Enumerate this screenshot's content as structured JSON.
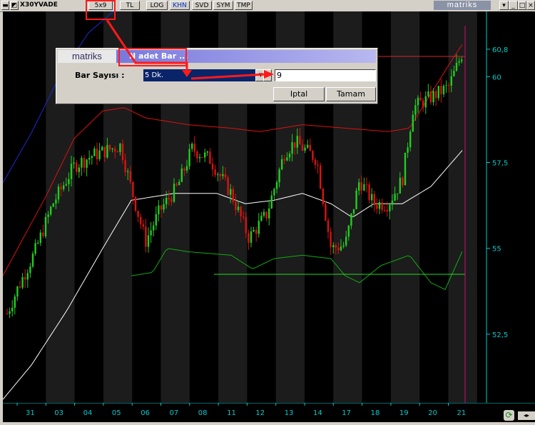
{
  "toolbar": {
    "symbol": "X30YVADE",
    "layout": "5x9",
    "buttons": [
      "TL",
      "LOG",
      "KHN",
      "SVD",
      "SYM",
      "TMP"
    ],
    "brand": "matriks",
    "active_button": "KHN"
  },
  "dialog": {
    "logo": "matriks",
    "title": "N adet Bar ...",
    "label": "Bar Sayısı :",
    "period": "5 Dk.",
    "bar_count": "9",
    "cancel": "Iptal",
    "ok": "Tamam"
  },
  "chart_data": {
    "type": "line",
    "price_axis_ticks": [
      "60,8",
      "60",
      "57,5",
      "55",
      "52,5"
    ],
    "price_ticks_values": [
      60.8,
      60,
      57.5,
      55,
      52.5
    ],
    "x_tick_labels": [
      "31",
      "03",
      "04",
      "05",
      "06",
      "07",
      "08",
      "11",
      "12",
      "13",
      "14",
      "17",
      "18",
      "19",
      "20",
      "21"
    ],
    "last_price": "60,8",
    "ylim": [
      50.5,
      61.9
    ]
  },
  "colors": {
    "background": "#000000",
    "bull": "#22cc22",
    "bear": "#dd1111",
    "upper_band": "#dd1111",
    "middle_band": "#ffffff",
    "lower_band": "#11aa11",
    "axis": "#00cccc",
    "highlight": "#ff1a1a"
  }
}
